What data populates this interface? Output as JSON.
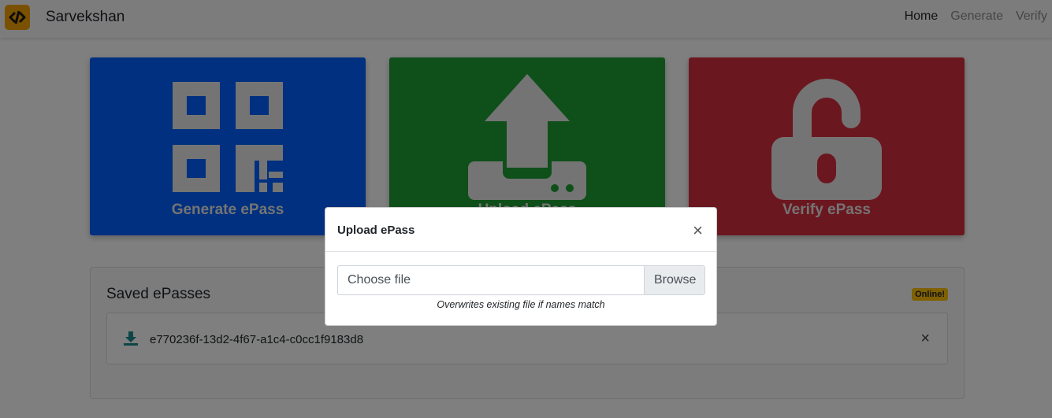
{
  "app": {
    "brand_name": "Sarvekshan",
    "logo_icon": "code-slash-icon",
    "accent": "#f5a300"
  },
  "nav": {
    "items": [
      {
        "label": "Home",
        "active": true
      },
      {
        "label": "Generate",
        "active": false
      },
      {
        "label": "Verify",
        "active": false
      }
    ]
  },
  "tiles": [
    {
      "label": "Generate ePass",
      "icon": "qr-code-icon",
      "color": "#0061ff"
    },
    {
      "label": "Upload ePass",
      "icon": "upload-icon",
      "color": "#1f9e35"
    },
    {
      "label": "Verify ePass",
      "icon": "unlock-icon",
      "color": "#d72f3e"
    }
  ],
  "saved": {
    "title": "Saved ePasses",
    "status_badge": "Online!",
    "items": [
      {
        "name": "e770236f-13d2-4f67-a1c4-c0cc1f9183d8",
        "icon": "download-icon",
        "remove_symbol": "×"
      }
    ]
  },
  "modal": {
    "title": "Upload ePass",
    "close_symbol": "×",
    "file_placeholder": "Choose file",
    "browse_label": "Browse",
    "help_text": "Overwrites existing file if names match"
  }
}
